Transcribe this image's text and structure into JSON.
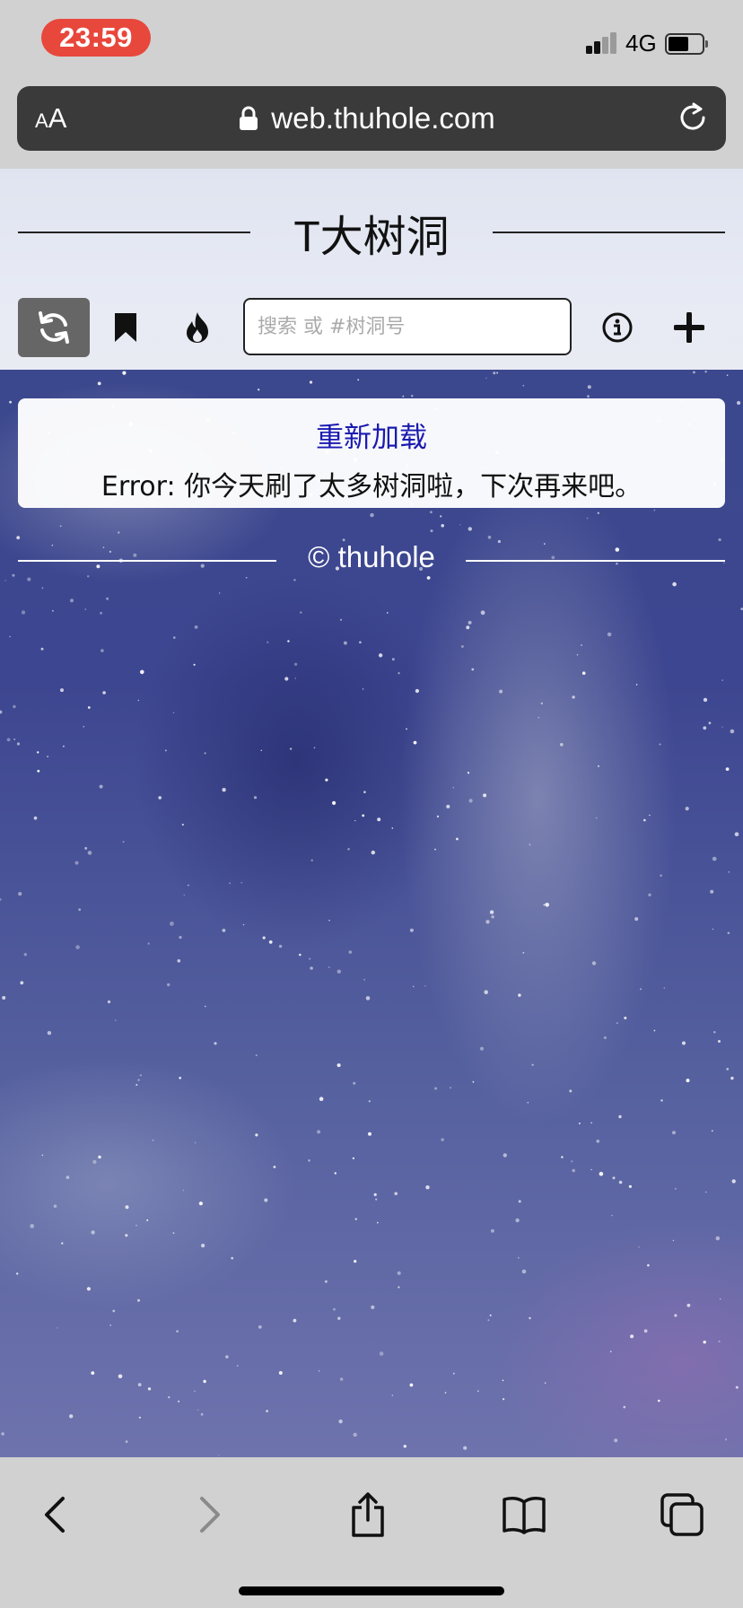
{
  "status_bar": {
    "time": "23:59",
    "network": "4G",
    "colors": {
      "time_pill": "#e8473c"
    }
  },
  "browser": {
    "text_size_label_small": "A",
    "text_size_label_large": "A",
    "url": "web.thuhole.com",
    "icons": [
      "lock-icon",
      "reload-icon"
    ]
  },
  "app": {
    "title": "T大树洞",
    "toolbar": {
      "icons": [
        "refresh-icon",
        "bookmark-icon",
        "flame-icon",
        "info-icon",
        "plus-icon"
      ],
      "search_placeholder": "搜索 或 #树洞号"
    },
    "error_card": {
      "reload_label": "重新加载",
      "message": "Error: 你今天刷了太多树洞啦，下次再来吧。"
    },
    "footer": "© thuhole",
    "colors": {
      "link": "#1a1ab0",
      "active_button": "#666666"
    }
  },
  "bottom_toolbar": {
    "icons": [
      "back-icon",
      "forward-icon",
      "share-icon",
      "bookmarks-icon",
      "tabs-icon"
    ]
  }
}
